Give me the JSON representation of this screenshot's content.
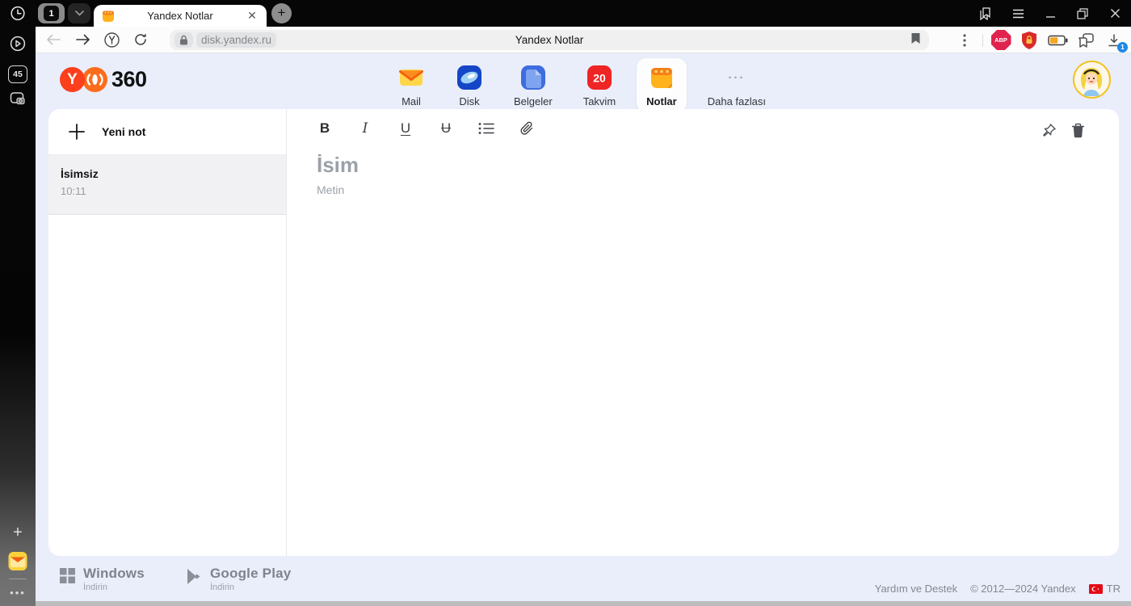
{
  "browser": {
    "tab_group_count": "1",
    "tab_title": "Yandex Notlar",
    "url": "disk.yandex.ru",
    "page_title": "Yandex Notlar",
    "abp_label": "ABP",
    "speed_badge": "45",
    "download_badge": "1"
  },
  "header": {
    "logo_text": "360",
    "apps": [
      {
        "label": "Mail"
      },
      {
        "label": "Disk"
      },
      {
        "label": "Belgeler"
      },
      {
        "label": "Takvim",
        "badge": "20"
      },
      {
        "label": "Notlar",
        "active": true
      },
      {
        "label": "Daha fazlası"
      }
    ]
  },
  "notes_sidebar": {
    "new_note_label": "Yeni not",
    "notes": [
      {
        "title": "İsimsiz",
        "time": "10:11"
      }
    ]
  },
  "editor": {
    "title_placeholder": "İsim",
    "body_placeholder": "Metin",
    "toolbar": {
      "bold": "B",
      "italic": "I",
      "underline": "U",
      "strikethrough": "U"
    }
  },
  "footer": {
    "windows_title": "Windows",
    "windows_subtitle": "İndirin",
    "gplay_title": "Google Play",
    "gplay_subtitle": "İndirin",
    "help_link": "Yardım ve Destek",
    "copyright": "© 2012—2024 Yandex",
    "lang": "TR"
  },
  "colors": {
    "accent_red": "#fc3f1d",
    "accent_orange": "#fb6d1d",
    "lavender_bg": "#e9eefa",
    "calendar_red": "#ef2424",
    "notes_yellow": "#ffb21c",
    "download_badge_blue": "#1e88e5"
  }
}
